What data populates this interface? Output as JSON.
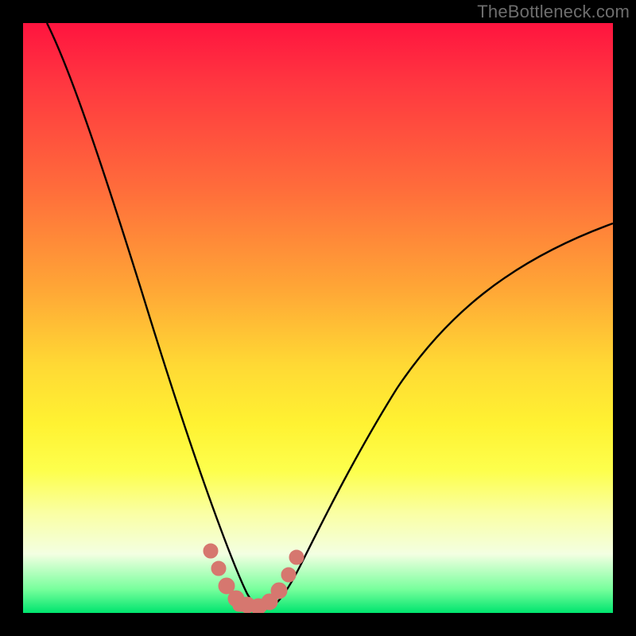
{
  "watermark": "TheBottleneck.com",
  "chart_data": {
    "type": "line",
    "title": "",
    "xlabel": "",
    "ylabel": "",
    "xlim": [
      0,
      100
    ],
    "ylim": [
      0,
      100
    ],
    "series": [
      {
        "name": "bottleneck-curve",
        "x": [
          4,
          8,
          12,
          16,
          20,
          24,
          28,
          31,
          33,
          35,
          36,
          38,
          40,
          42,
          44,
          47,
          52,
          58,
          66,
          76,
          88,
          100
        ],
        "y": [
          100,
          90,
          79,
          67,
          55,
          43,
          30,
          18,
          10,
          5,
          2,
          0.5,
          0.5,
          2,
          5,
          10,
          18,
          27,
          37,
          47,
          57,
          66
        ]
      }
    ],
    "markers": {
      "name": "optimum-band",
      "color": "#d6776f",
      "x": [
        30.5,
        32,
        33.5,
        35,
        37,
        39,
        41,
        43,
        44.5,
        46
      ],
      "y": [
        11,
        8,
        4,
        2,
        1,
        1,
        2,
        4,
        7,
        10
      ]
    },
    "background_gradient": {
      "top": "#ff143f",
      "mid": "#fff232",
      "bottom": "#00e46e"
    }
  }
}
